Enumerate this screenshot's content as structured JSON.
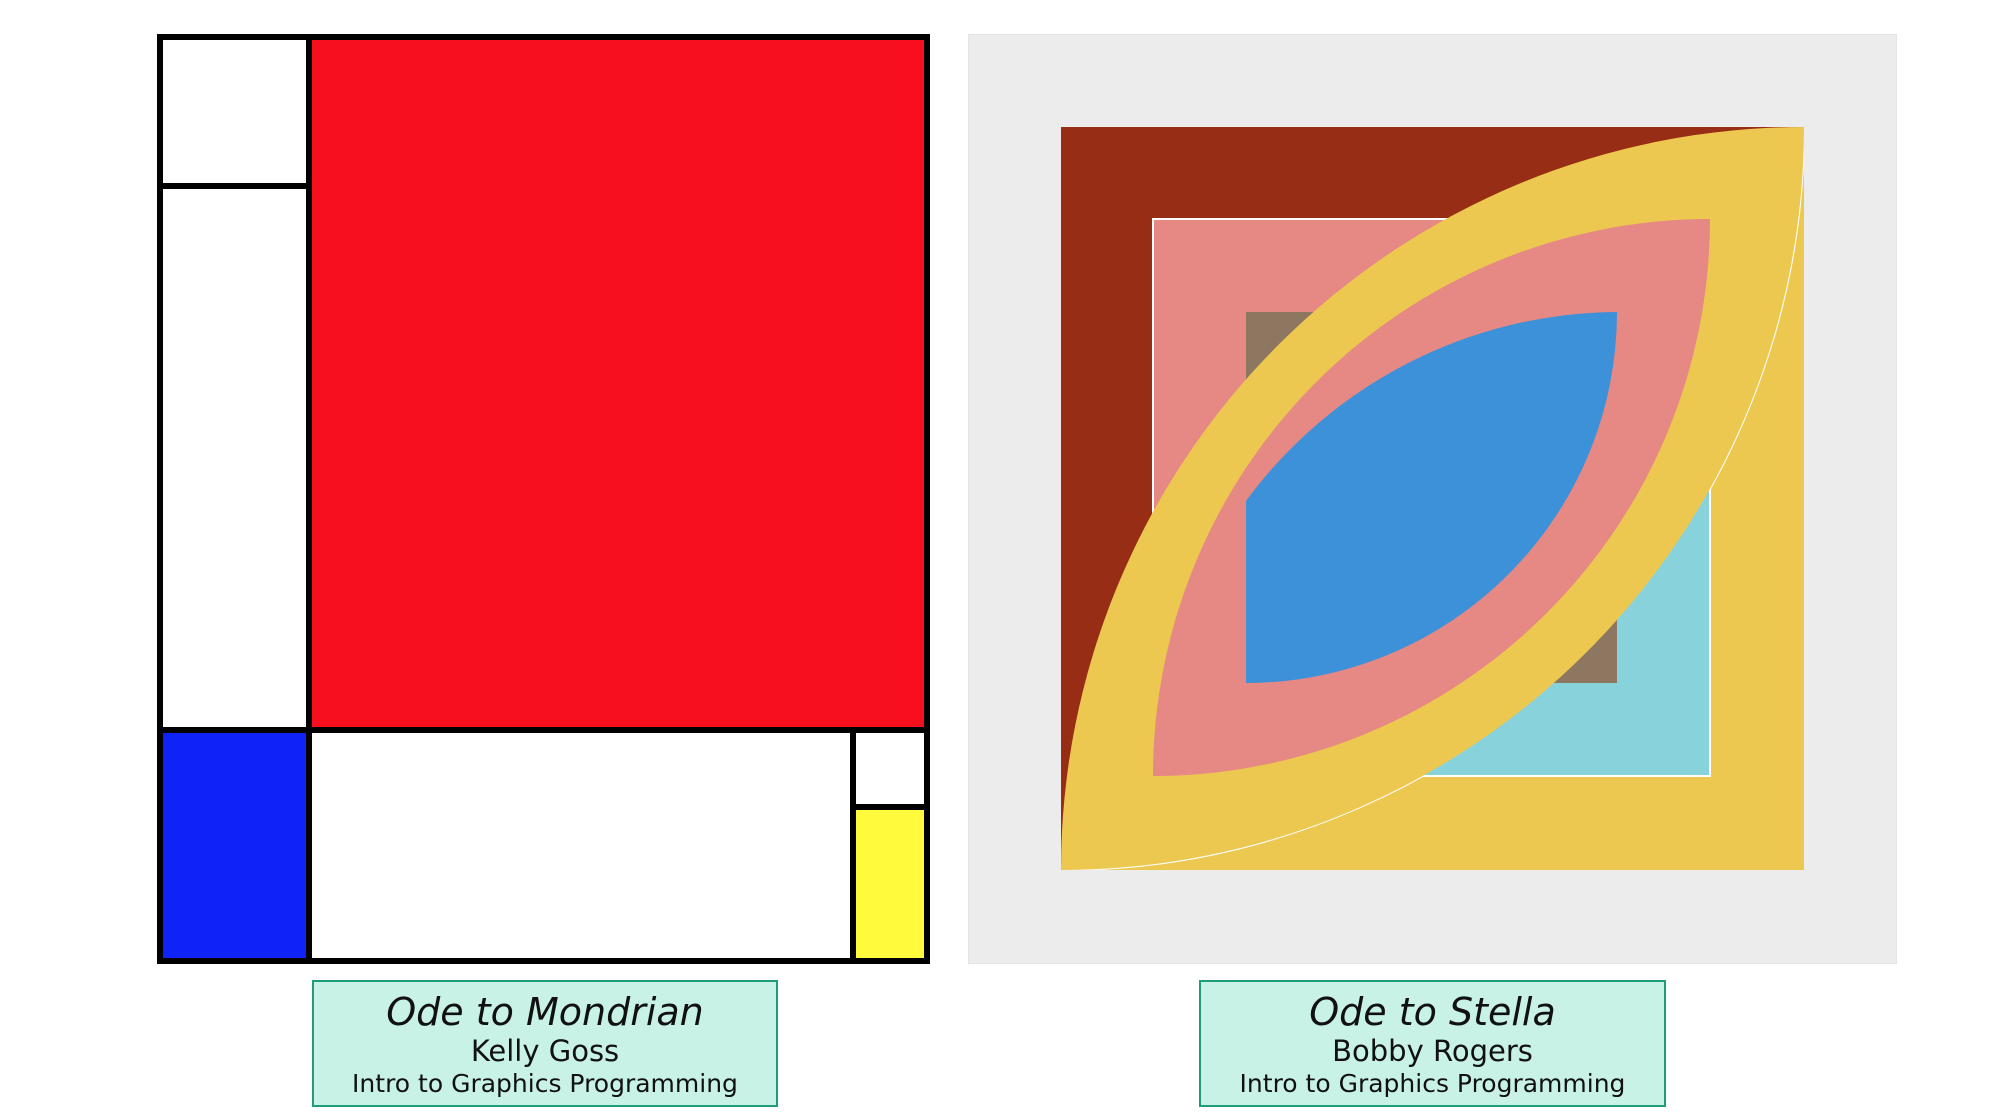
{
  "artworks": [
    {
      "title": "Ode to Mondrian",
      "author": "Kelly Goss",
      "course": "Intro to Graphics Programming",
      "colors": {
        "red": "#f80f1e",
        "blue": "#0f23f8",
        "yellow": "#fffb3c",
        "white": "#ffffff",
        "lines": "#000000"
      }
    },
    {
      "title": "Ode to Stella",
      "author": "Bobby Rogers",
      "course": "Intro to Graphics Programming",
      "colors": {
        "background": "#ececec",
        "maroon": "#972d15",
        "gold": "#ecc850",
        "salmon": "#e68884",
        "light_blue": "#88d2dc",
        "blue": "#3c91d9",
        "brown": "#8d7760"
      }
    }
  ],
  "caption_style": {
    "background": "#c8f2e6",
    "border": "#1f9d7b"
  }
}
